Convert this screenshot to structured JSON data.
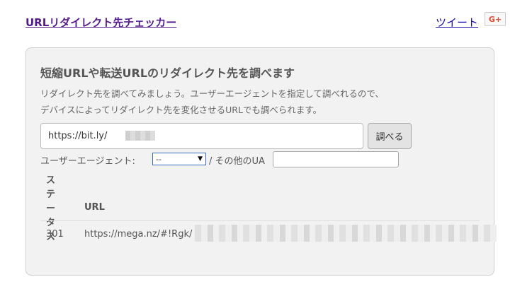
{
  "header": {
    "site_title": "URLリダイレクト先チェッカー",
    "tweet_label": "ツイート",
    "gplus_label": "G+"
  },
  "panel": {
    "title": "短縮URLや転送URLのリダイレクト先を調べます",
    "desc_line1": "リダイレクト先を調べてみましょう。ユーザーエージェントを指定して調べれるので、",
    "desc_line2": "デバイスによってリダイレクト先を変化させるURLでも調べられます。"
  },
  "form": {
    "url_value": "https://bit.ly/",
    "lookup_button": "調べる",
    "ua_label": "ユーザーエージェント:",
    "ua_selected": "--",
    "other_ua_label": "/ その他のUA",
    "other_ua_value": ""
  },
  "results": {
    "headers": [
      "ステータス",
      "URL"
    ],
    "rows": [
      {
        "status": "301",
        "url": "https://mega.nz/#!Rgk/"
      }
    ]
  },
  "icons": {
    "select_arrow": "chevron-down-icon"
  },
  "colors": {
    "panel_bg": "#f2f2f2",
    "visited_link": "#551a8b",
    "link": "#1a0dab",
    "gplus_red": "#dd4b39"
  }
}
